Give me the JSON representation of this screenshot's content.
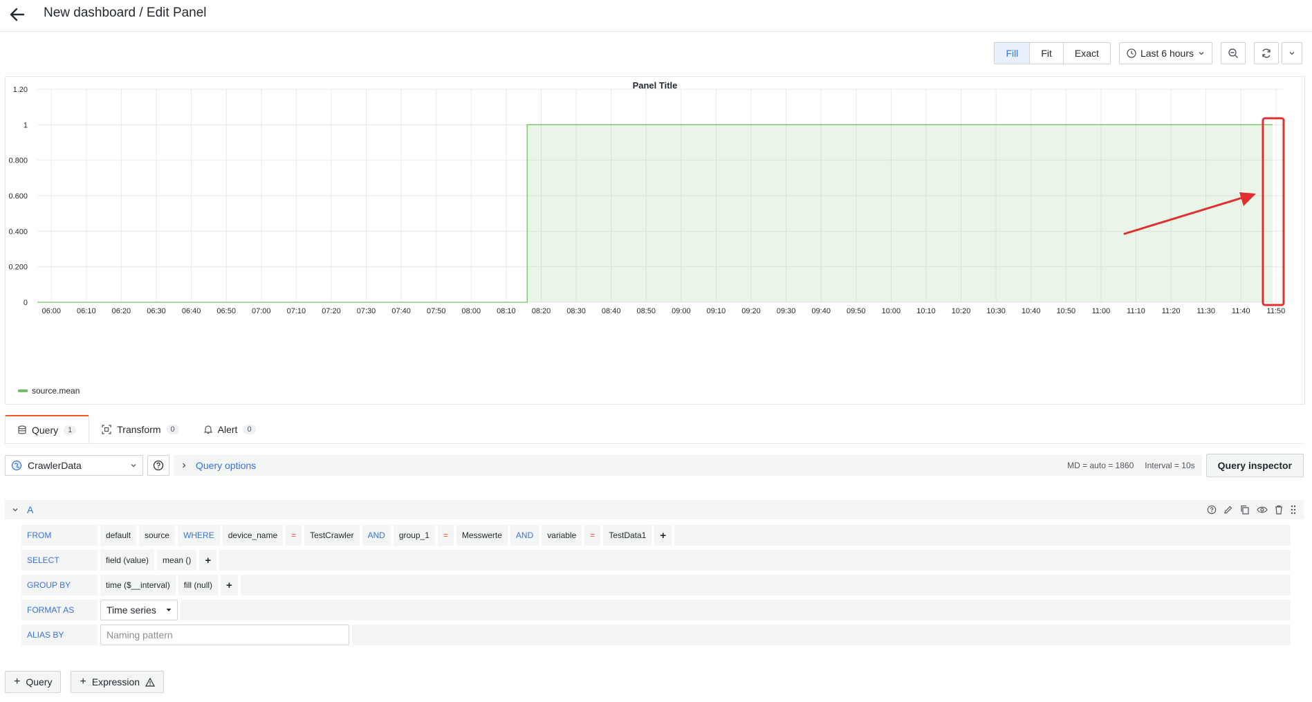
{
  "header": {
    "title": "New dashboard / Edit Panel"
  },
  "toolbar": {
    "display_modes": [
      "Fill",
      "Fit",
      "Exact"
    ],
    "active_mode": "Fill",
    "time_range": "Last 6 hours"
  },
  "panel": {
    "title": "Panel Title",
    "legend": "source.mean",
    "annotation_color": "#e02f2f"
  },
  "chart_data": {
    "type": "area",
    "title": "Panel Title",
    "y_ticks": [
      "0",
      "0.200",
      "0.400",
      "0.600",
      "0.800",
      "1",
      "1.20"
    ],
    "ylim": [
      0,
      1.2
    ],
    "x_ticks": [
      "06:00",
      "06:10",
      "06:20",
      "06:30",
      "06:40",
      "06:50",
      "07:00",
      "07:10",
      "07:20",
      "07:30",
      "07:40",
      "07:50",
      "08:00",
      "08:10",
      "08:20",
      "08:30",
      "08:40",
      "08:50",
      "09:00",
      "09:10",
      "09:20",
      "09:30",
      "09:40",
      "09:50",
      "10:00",
      "10:10",
      "10:20",
      "10:30",
      "10:40",
      "10:50",
      "11:00",
      "11:10",
      "11:20",
      "11:30",
      "11:40",
      "11:50"
    ],
    "xlim": [
      "05:56",
      "11:52"
    ],
    "series": [
      {
        "name": "source.mean",
        "color": "#73bf69",
        "x": [
          "05:56",
          "08:16",
          "08:16",
          "11:49"
        ],
        "y": [
          0,
          0,
          1,
          1
        ]
      }
    ],
    "grid": true,
    "legend_position": "bottom-left"
  },
  "tabs": [
    {
      "label": "Query",
      "count": "1"
    },
    {
      "label": "Transform",
      "count": "0"
    },
    {
      "label": "Alert",
      "count": "0"
    }
  ],
  "query_row": {
    "datasource": "CrawlerData",
    "options_label": "Query options",
    "md": "MD = auto = 1860",
    "interval": "Interval = 10s",
    "inspector": "Query inspector"
  },
  "query": {
    "ref_id": "A",
    "from": {
      "label": "FROM",
      "items": [
        {
          "text": "default",
          "kind": "value"
        },
        {
          "text": "source",
          "kind": "value"
        },
        {
          "text": "WHERE",
          "kind": "kw"
        },
        {
          "text": "device_name",
          "kind": "value"
        },
        {
          "text": "=",
          "kind": "op"
        },
        {
          "text": "TestCrawler",
          "kind": "value"
        },
        {
          "text": "AND",
          "kind": "kw"
        },
        {
          "text": "group_1",
          "kind": "value"
        },
        {
          "text": "=",
          "kind": "op"
        },
        {
          "text": "Messwerte",
          "kind": "value"
        },
        {
          "text": "AND",
          "kind": "kw"
        },
        {
          "text": "variable",
          "kind": "value"
        },
        {
          "text": "=",
          "kind": "op"
        },
        {
          "text": "TestData1",
          "kind": "value"
        },
        {
          "text": "+",
          "kind": "plus"
        }
      ]
    },
    "select": {
      "label": "SELECT",
      "items": [
        {
          "text": "field (value)",
          "kind": "value"
        },
        {
          "text": "mean ()",
          "kind": "value"
        },
        {
          "text": "+",
          "kind": "plus"
        }
      ]
    },
    "group_by": {
      "label": "GROUP BY",
      "items": [
        {
          "text": "time ($__interval)",
          "kind": "value"
        },
        {
          "text": "fill (null)",
          "kind": "value"
        },
        {
          "text": "+",
          "kind": "plus"
        }
      ]
    },
    "format_as": {
      "label": "FORMAT AS",
      "value": "Time series"
    },
    "alias_by": {
      "label": "ALIAS BY",
      "placeholder": "Naming pattern"
    }
  },
  "bottom": {
    "add_query": "Query",
    "add_expression": "Expression"
  }
}
